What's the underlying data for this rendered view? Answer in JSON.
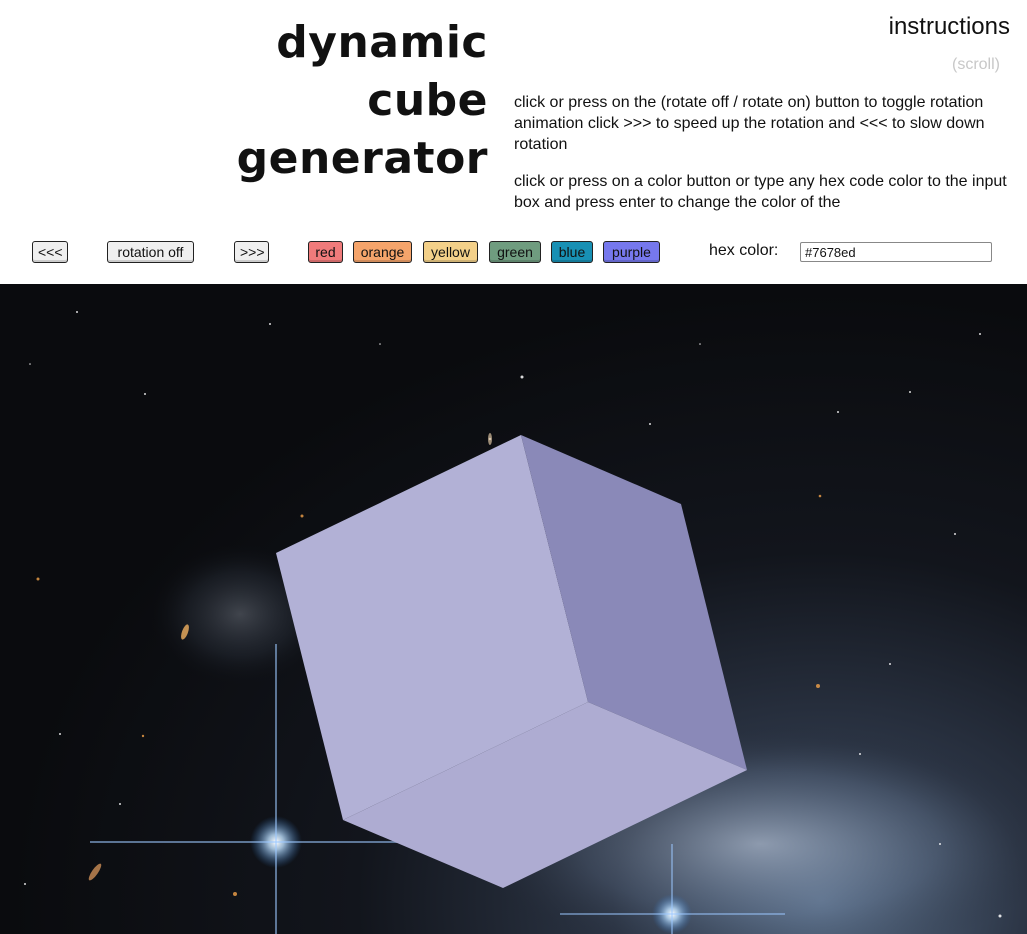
{
  "header": {
    "title": "dynamic cube generator",
    "instructions_heading": "instructions",
    "scroll_hint": "(scroll)",
    "instructions": [
      "click or press on the (rotate off / rotate on) button to toggle rotation animation click >>> to speed up the rotation and <<< to slow down rotation",
      "click or press on a color button or type any hex code color to the input box and press enter to change the color of the"
    ]
  },
  "controls": {
    "slower_label": "<<<",
    "rotation_label": "rotation off",
    "faster_label": ">>>",
    "colors": [
      {
        "label": "red",
        "color": "#f07b7b"
      },
      {
        "label": "orange",
        "color": "#f5a46b"
      },
      {
        "label": "yellow",
        "color": "#f3d089"
      },
      {
        "label": "green",
        "color": "#6f9c7f"
      },
      {
        "label": "blue",
        "color": "#1890b4"
      },
      {
        "label": "purple",
        "color": "#7678ed"
      }
    ],
    "hex_label": "hex color:",
    "hex_value": "#7678ed"
  },
  "cube": {
    "color": "#7678ed",
    "face_colors": [
      "#b2b1d6",
      "#8a89b8",
      "#aeacd2"
    ]
  }
}
